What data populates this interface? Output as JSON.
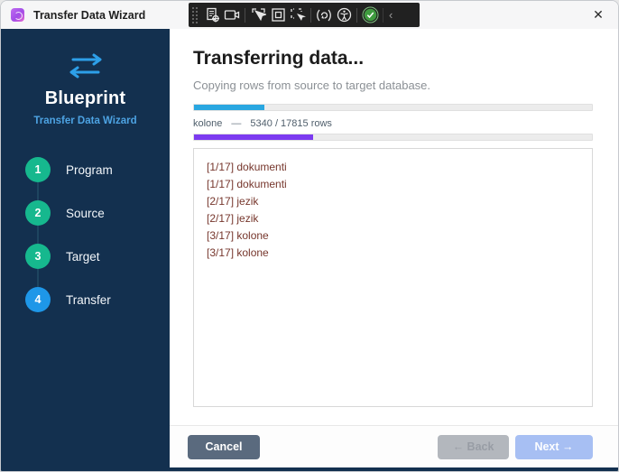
{
  "window": {
    "title": "Transfer Data Wizard",
    "close_icon": "✕"
  },
  "toolbar": {
    "icon_groups": [
      [
        "annotate-script-icon",
        "camera-icon"
      ],
      [
        "cursor-select-icon",
        "region-select-icon",
        "cursor-capture-icon"
      ],
      [
        "sync-icon",
        "accessibility-icon"
      ],
      [
        "status-check-icon"
      ]
    ],
    "collapse_icon": "‹",
    "check_color": "#4caf50"
  },
  "sidebar": {
    "brand": "Blueprint",
    "subtitle": "Transfer Data Wizard",
    "brand_arrow_color": "#2d9fe8",
    "steps": [
      {
        "number": "1",
        "label": "Program",
        "state": "done"
      },
      {
        "number": "2",
        "label": "Source",
        "state": "done"
      },
      {
        "number": "3",
        "label": "Target",
        "state": "done"
      },
      {
        "number": "4",
        "label": "Transfer",
        "state": "active"
      }
    ],
    "done_color": "#16b88e",
    "active_color": "#1e97e8"
  },
  "main": {
    "title": "Transferring data...",
    "subtitle": "Copying rows from source to target database.",
    "overall_percent": 17.6,
    "overall_color": "#29a7e1",
    "table_progress": {
      "table": "kolone",
      "dash": "—",
      "counts": "5340 / 17815 rows",
      "current": 5340,
      "total": 17815,
      "color": "#7c3bf0"
    },
    "log_entries": [
      "[1/17] dokumenti",
      "[1/17] dokumenti",
      "[2/17] jezik",
      "[2/17] jezik",
      "[3/17] kolone",
      "[3/17] kolone"
    ]
  },
  "footer": {
    "cancel": "Cancel",
    "back": "← Back",
    "next": "Next →"
  }
}
